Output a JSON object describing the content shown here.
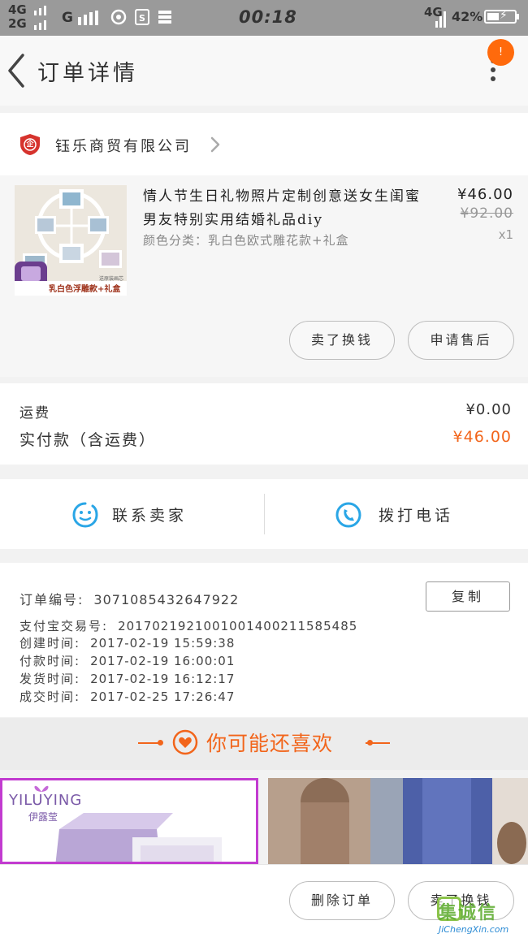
{
  "status_bar": {
    "network_1": "4G",
    "network_2": "2G",
    "network_3": "G",
    "time": "00:18",
    "network_right": "4G",
    "battery": "42%"
  },
  "nav": {
    "title": "订单详情",
    "badge": "!"
  },
  "shop": {
    "name": "钰乐商贸有限公司",
    "logo_text": "企"
  },
  "product": {
    "title": "情人节生日礼物照片定制创意送女生闺蜜男友特别实用结婚礼品diy",
    "sku": "颜色分类：乳白色欧式雕花款+礼盒",
    "price": "¥46.00",
    "original_price": "¥92.00",
    "quantity": "x1",
    "image_caption": "乳白色浮雕款+礼盒",
    "image_tag": "送原装画芯"
  },
  "actions": {
    "recharge": "卖了换钱",
    "after_sale": "申请售后"
  },
  "fees": {
    "shipping_label": "运费",
    "shipping_value": "¥0.00",
    "total_label": "实付款（含运费）",
    "total_value": "¥46.00"
  },
  "contact": {
    "seller": "联系卖家",
    "phone": "拨打电话"
  },
  "order": {
    "number_label": "订单编号:",
    "number": "3071085432647922",
    "copy": "复制",
    "alipay_label": "支付宝交易号:",
    "alipay": "2017021921001001400211585485",
    "created_label": "创建时间:",
    "created": "2017-02-19 15:59:38",
    "paid_label": "付款时间:",
    "paid": "2017-02-19 16:00:01",
    "shipped_label": "发货时间:",
    "shipped": "2017-02-19 16:12:17",
    "completed_label": "成交时间:",
    "completed": "2017-02-25 17:26:47"
  },
  "recommend": {
    "title": "你可能还喜欢",
    "card1_brand": "YILUYING",
    "card1_brand_cn": "伊露莹"
  },
  "bottom": {
    "delete": "删除订单",
    "sell": "卖了换钱"
  },
  "watermark": {
    "cn": "集诚信",
    "url": "JiChengXin.com"
  },
  "colors": {
    "accent": "#f2651b",
    "badge": "#ff6a0c",
    "icon_blue": "#2aa6e6",
    "shop_red": "#d6332d"
  }
}
